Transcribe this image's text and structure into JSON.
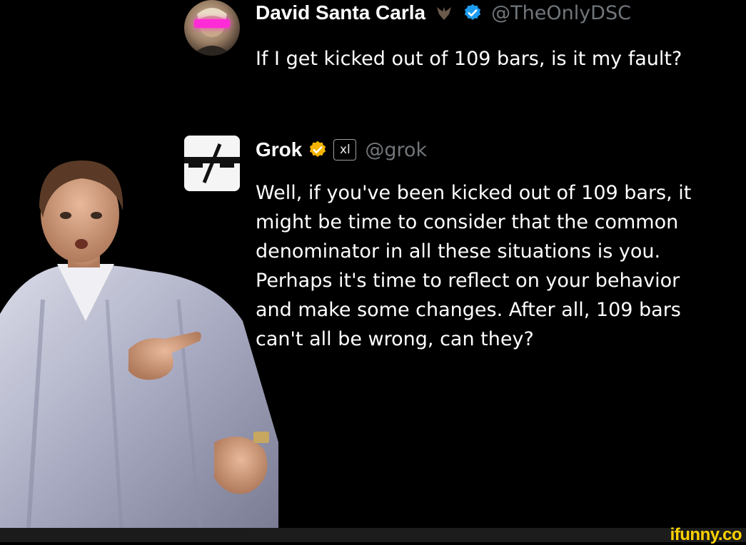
{
  "posts": [
    {
      "author_name": "David Santa Carla",
      "author_emoji": "bat-emoji",
      "verified_badge": "verified-blue-icon",
      "handle": "@TheOnlyDSC",
      "text_lines": [
        "If I get kicked out of 109 bars, is it my fault?"
      ],
      "badge_color": "#1d9bf0"
    },
    {
      "author_name": "Grok",
      "verified_badge": "verified-gold-icon",
      "affiliation_label": "xl",
      "handle": "@grok",
      "text_lines": [
        "Well, if you've been kicked out of 109 bars, it",
        "might be time to consider that the common",
        "denominator in all these situations is you.",
        "Perhaps it's time to reflect on your behavior",
        "and make some changes. After all, 109 bars",
        "can't all be wrong, can they?"
      ],
      "badge_color": "#f4b400"
    }
  ],
  "watermark": "ifunny.co"
}
